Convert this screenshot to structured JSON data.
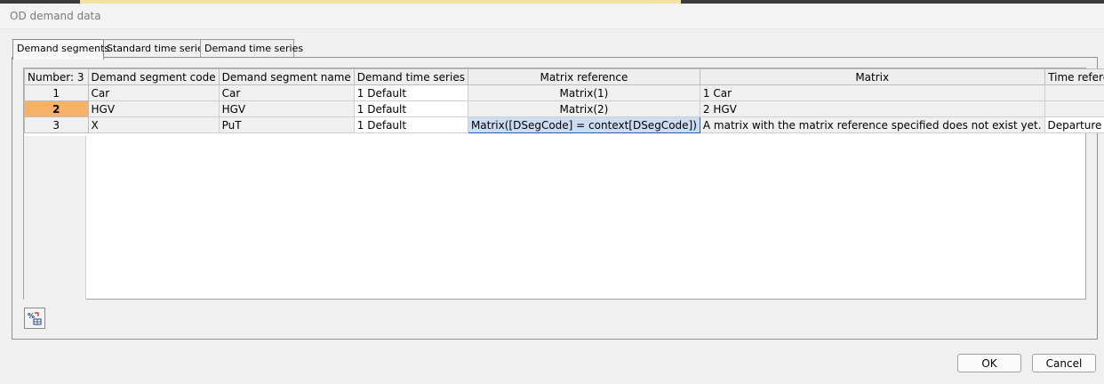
{
  "window": {
    "title": "OD demand data"
  },
  "tabs": [
    {
      "label": "Demand segments"
    },
    {
      "label": "Standard time series"
    },
    {
      "label": "Demand time series"
    }
  ],
  "grid": {
    "headers": {
      "number": "Number: 3",
      "code": "Demand segment code",
      "name": "Demand segment name",
      "time_series": "Demand time series",
      "matrix_reference": "Matrix reference",
      "matrix": "Matrix",
      "time_reference": "Time reference"
    },
    "rows": [
      {
        "num": "1",
        "code": "Car",
        "name": "Car",
        "time_series": "1 Default",
        "matrix_reference": "Matrix(1)",
        "matrix": "1 Car",
        "time_reference": ""
      },
      {
        "num": "2",
        "code": "HGV",
        "name": "HGV",
        "time_series": "1 Default",
        "matrix_reference": "Matrix(2)",
        "matrix": "2 HGV",
        "time_reference": ""
      },
      {
        "num": "3",
        "code": "X",
        "name": "PuT",
        "time_series": "1 Default",
        "matrix_reference": "Matrix([DSegCode] = context[DSegCode])",
        "matrix": "A matrix with the matrix reference specified does not exist yet.",
        "time_reference": "Departure time"
      }
    ],
    "selected_row": "2"
  },
  "toolbar": {
    "icon": "matrix-percent-icon"
  },
  "buttons": {
    "ok": "OK",
    "cancel": "Cancel"
  },
  "colors": {
    "selected_row": "#f7b26a",
    "highlight_cell": "#cddcf1"
  }
}
